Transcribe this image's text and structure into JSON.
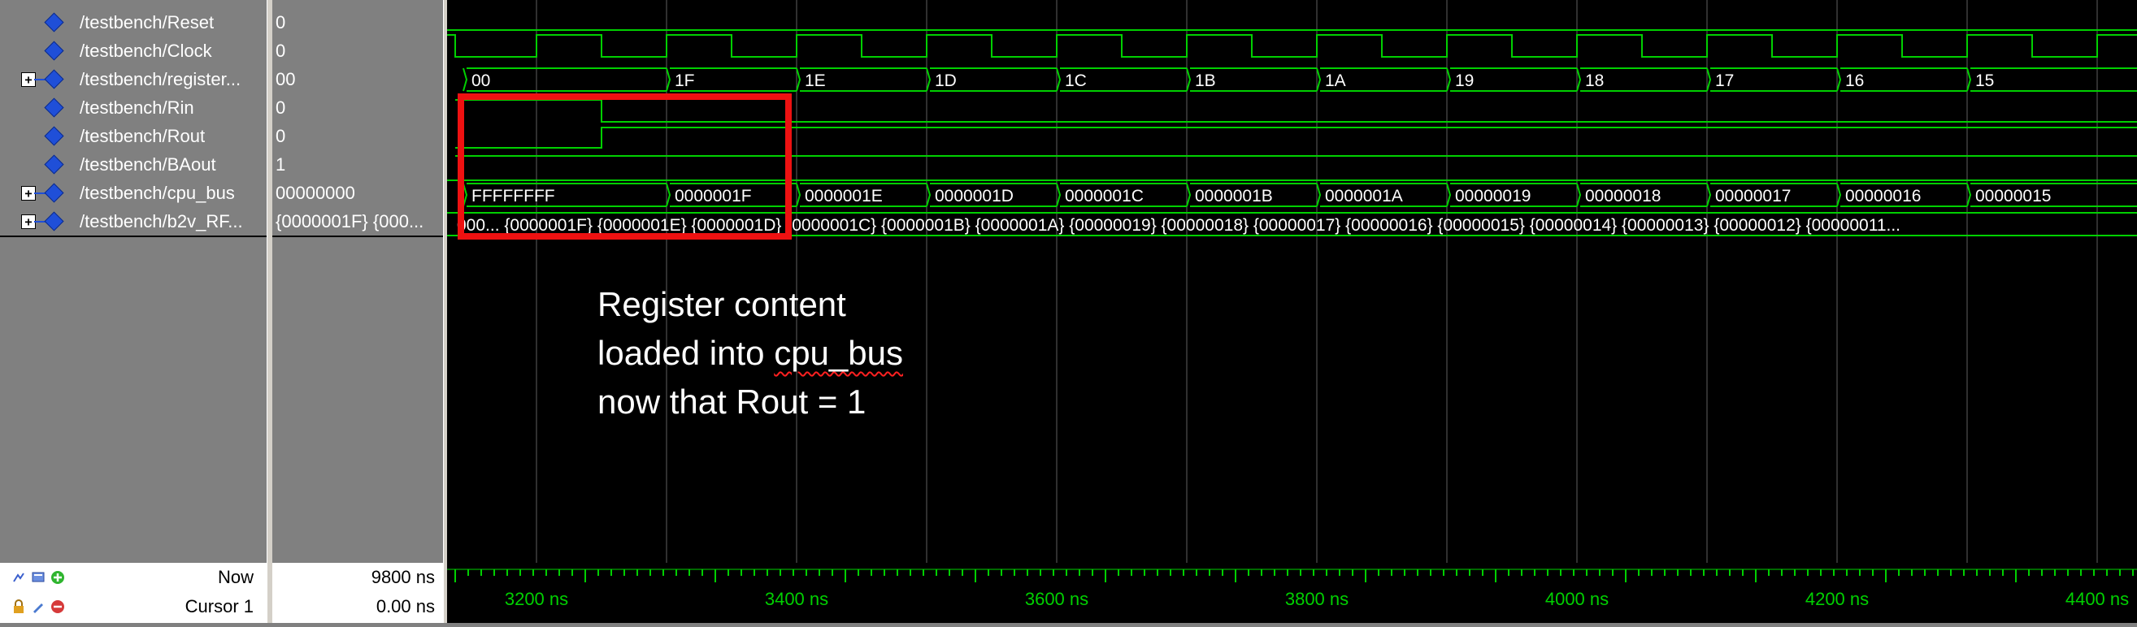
{
  "signals": [
    {
      "name": "/testbench/Reset",
      "value": "0",
      "expandable": false
    },
    {
      "name": "/testbench/Clock",
      "value": "0",
      "expandable": false
    },
    {
      "name": "/testbench/register...",
      "value": "00",
      "expandable": true
    },
    {
      "name": "/testbench/Rin",
      "value": "0",
      "expandable": false
    },
    {
      "name": "/testbench/Rout",
      "value": "0",
      "expandable": false
    },
    {
      "name": "/testbench/BAout",
      "value": "1",
      "expandable": false
    },
    {
      "name": "/testbench/cpu_bus",
      "value": "00000000",
      "expandable": true
    },
    {
      "name": "/testbench/b2v_RF...",
      "value": "{0000001F} {000...",
      "expandable": true
    }
  ],
  "waves": {
    "register_segments": [
      "00",
      "1F",
      "1E",
      "1D",
      "1C",
      "1B",
      "1A",
      "19",
      "18",
      "17",
      "16",
      "15"
    ],
    "cpu_bus_segments": [
      "FFFFFFFF",
      "0000001F",
      "0000001E",
      "0000001D",
      "0000001C",
      "0000001B",
      "0000001A",
      "00000019",
      "00000018",
      "00000017",
      "00000016",
      "00000015"
    ],
    "rf_text": "000...  {0000001F} {0000001E} {0000001D} {0000001C} {0000001B} {0000001A} {00000019} {00000018} {00000017} {00000016} {00000015} {00000014} {00000013} {00000012} {00000011..."
  },
  "footer": {
    "now_label": "Now",
    "now_value": "9800 ns",
    "cursor_label": "Cursor 1",
    "cursor_value": "0.00 ns"
  },
  "timeline": {
    "labels": [
      "3200 ns",
      "3400 ns",
      "3600 ns",
      "3800 ns",
      "4000 ns",
      "4200 ns",
      "4400 ns"
    ]
  },
  "annotation": {
    "line1": "Register content",
    "line2_prefix": "loaded into ",
    "line2_word": "cpu_bus",
    "line3": "now that Rout = 1"
  },
  "colors": {
    "wave": "#00d000",
    "grid": "#606060",
    "highlight": "#ee1111",
    "diamond": "#1f4fd8"
  }
}
